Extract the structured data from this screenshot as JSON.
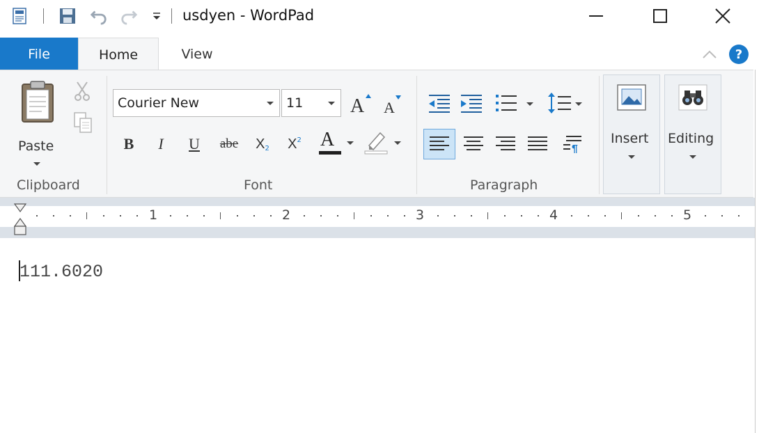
{
  "window": {
    "title": "usdyen - WordPad",
    "minimize_label": "",
    "maximize_label": "",
    "close_label": ""
  },
  "ribbon_tabs": {
    "file": "File",
    "home": "Home",
    "view": "View",
    "help_glyph": "?"
  },
  "clipboard": {
    "paste_label": "Paste",
    "group_label": "Clipboard"
  },
  "font": {
    "family": "Courier New",
    "size": "11",
    "group_label": "Font",
    "bold_glyph": "B",
    "italic_glyph": "I",
    "underline_glyph": "U",
    "strike_glyph": "abe",
    "subscript_glyph": "X",
    "superscript_glyph": "X",
    "color_glyph": "A"
  },
  "paragraph": {
    "group_label": "Paragraph"
  },
  "insert": {
    "label": "Insert"
  },
  "editing": {
    "label": "Editing"
  },
  "ruler": {
    "numbers": [
      "1",
      "2",
      "3",
      "4",
      "5"
    ]
  },
  "document": {
    "text": "111.6020"
  },
  "colors": {
    "accent": "#1979ca",
    "ribbon_bg": "#f5f6f7",
    "ruler_bg": "#dbe1e8",
    "font_color_bar": "#1f1f1f"
  },
  "icons": {
    "app": "wordpad-app-icon",
    "save": "save-icon",
    "undo": "undo-icon",
    "redo": "redo-icon",
    "customize": "customize-qat-icon",
    "paste": "clipboard-icon",
    "cut": "scissors-icon",
    "copy": "copy-icon",
    "help": "help-icon"
  }
}
